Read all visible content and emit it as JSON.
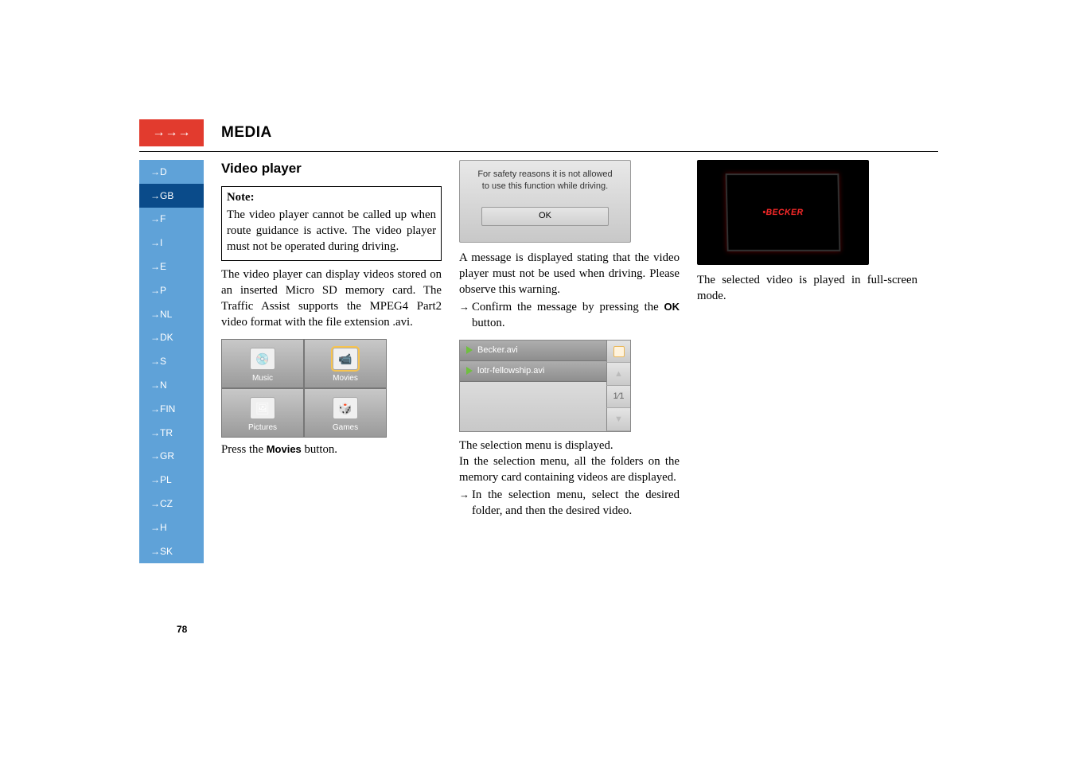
{
  "header": {
    "arrows": "→→→",
    "title": "MEDIA"
  },
  "langs": [
    "D",
    "GB",
    "F",
    "I",
    "E",
    "P",
    "NL",
    "DK",
    "S",
    "N",
    "FIN",
    "TR",
    "GR",
    "PL",
    "CZ",
    "H",
    "SK"
  ],
  "active_lang_index": 1,
  "col1": {
    "title": "Video player",
    "note_label": "Note:",
    "note_body": "The video player cannot be called up when route guidance is active.\nThe video player must not be operated during driving.",
    "para": "The video player can display videos stored on an inserted Micro SD memory card.\nThe Traffic Assist supports the MPEG4 Part2 video format with the file extension .avi.",
    "tiles": [
      "Music",
      "Movies",
      "Pictures",
      "Games"
    ],
    "selected_tile_index": 1,
    "tile_emoji": [
      "💿",
      "📹",
      "🖼",
      "🎲"
    ],
    "press_text_pre": "Press the ",
    "press_text_btn": "Movies",
    "press_text_post": " button."
  },
  "col2": {
    "safety_line1": "For safety reasons it is not allowed",
    "safety_line2": "to use this function while driving.",
    "ok_label": "OK",
    "msg_para": "A message is displayed stating that the video player must not be used when driving. Please observe this warning.",
    "step1_pre": "Confirm the message by pressing the ",
    "step1_btn": "OK",
    "step1_post": " button.",
    "videos": [
      "Becker.avi",
      "lotr-fellowship.avi"
    ],
    "page_indicator": "1⁄1",
    "sel_para1": "The selection menu is displayed.",
    "sel_para2": "In the selection menu, all the folders on the memory card containing videos are displayed.",
    "step2": "In the selection menu, select the desired folder, and then the desired video."
  },
  "col3": {
    "logo": "•BECKER",
    "caption": "The selected video is played in full-screen mode."
  },
  "page_number": "78"
}
